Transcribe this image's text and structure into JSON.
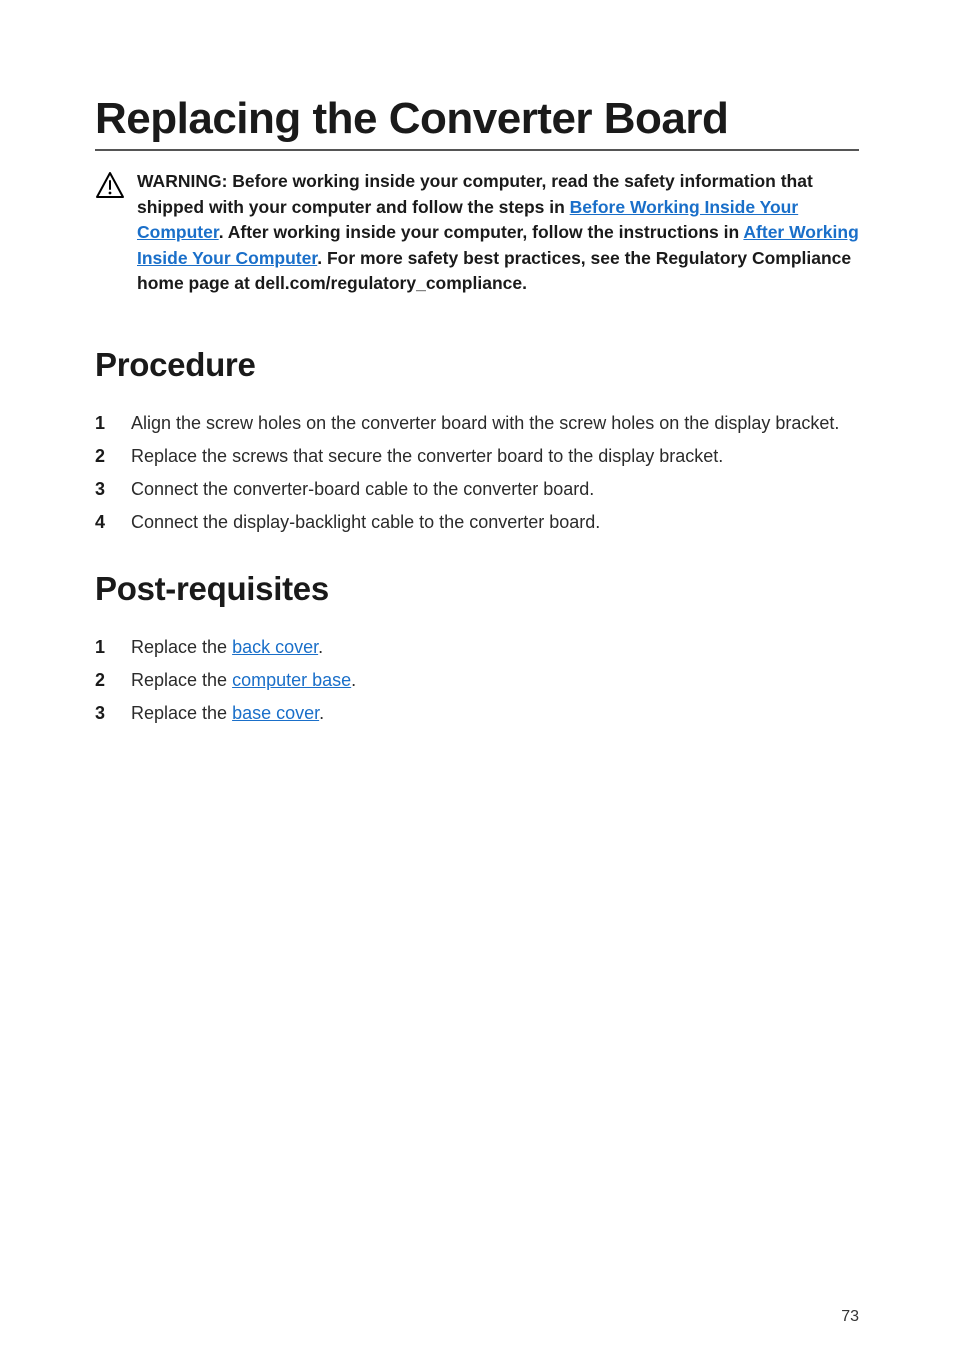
{
  "title": "Replacing the Converter Board",
  "warning": {
    "pre_link1": "WARNING: Before working inside your computer, read the safety information that shipped with your computer and follow the steps in ",
    "link1": "Before Working Inside Your Computer",
    "between1": ". After working inside your computer, follow the instructions in ",
    "link2": "After Working Inside Your Computer",
    "after": ". For more safety best practices, see the Regulatory Compliance home page at dell.com/regulatory_compliance."
  },
  "sections": {
    "procedure": {
      "heading": "Procedure",
      "steps": [
        "Align the screw holes on the converter board with the screw holes on the display bracket.",
        "Replace the screws that secure the converter board to the display bracket.",
        "Connect the converter-board cable to the converter board.",
        "Connect the display-backlight cable to the converter board."
      ],
      "nums": [
        "1",
        "2",
        "3",
        "4"
      ]
    },
    "post": {
      "heading": "Post-requisites",
      "steps": [
        {
          "pre": "Replace the ",
          "link": "back cover",
          "post": "."
        },
        {
          "pre": "Replace the ",
          "link": "computer base",
          "post": "."
        },
        {
          "pre": "Replace the ",
          "link": "base cover",
          "post": "."
        }
      ],
      "nums": [
        "1",
        "2",
        "3"
      ]
    }
  },
  "page_number": "73"
}
